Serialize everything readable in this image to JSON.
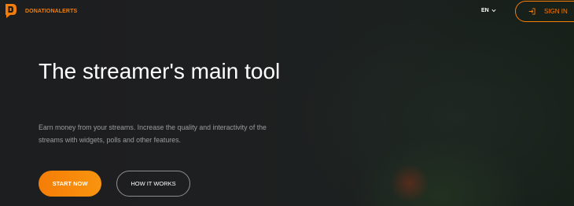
{
  "header": {
    "brand": "DONATIONALERTS",
    "logo_icon": "donationalerts-logo-icon",
    "language": "EN",
    "language_chevron_icon": "chevron-down-icon",
    "signin_icon": "sign-in-icon",
    "signin_label": "SIGN IN"
  },
  "hero": {
    "title": "The streamer's main tool",
    "subtitle": "Earn money from your streams. Increase the quality and interactivity of the streams with widgets, polls and other features.",
    "primary_button": "START NOW",
    "secondary_button": "HOW IT WORKS"
  },
  "colors": {
    "accent": "#f57d07",
    "background": "#1a1b1c",
    "subtitle_text": "#9a9c9e"
  }
}
